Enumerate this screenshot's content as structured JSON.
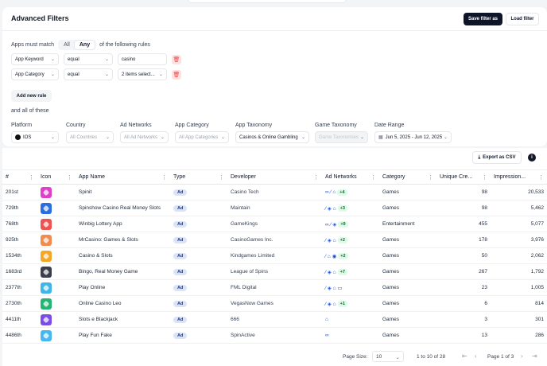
{
  "header": {
    "title": "Advanced Filters",
    "save_label": "Save filter as",
    "load_label": "Load filter"
  },
  "match": {
    "prefix": "Apps must match",
    "options": [
      "All",
      "Any"
    ],
    "selected": "Any",
    "suffix": "of the following rules"
  },
  "rules": [
    {
      "field": "App Keyword",
      "operator": "equal",
      "value": "casino"
    },
    {
      "field": "App Category",
      "operator": "equal",
      "value": "2 items select..."
    }
  ],
  "add_rule_label": "Add new rule",
  "and_all_label": "and all of these",
  "filters": {
    "platform": {
      "label": "Platform",
      "value": "IOS"
    },
    "country": {
      "label": "Country",
      "placeholder": "All Countries"
    },
    "ad_networks": {
      "label": "Ad Networks",
      "placeholder": "All Ad Networks"
    },
    "app_category": {
      "label": "App Category",
      "placeholder": "All App Categories"
    },
    "app_taxonomy": {
      "label": "App Taxonomy",
      "value": "Casinos & Online Gambling"
    },
    "game_taxonomy": {
      "label": "Game Taxonomy",
      "placeholder": "Game Taxonomies"
    },
    "date_range": {
      "label": "Date Range",
      "value": "Jun 5, 2025 - Jun 12, 2025"
    }
  },
  "export_label": "Export as CSV",
  "info_label": "i",
  "columns": [
    "#",
    "Icon",
    "App Name",
    "Type",
    "Developer",
    "Ad Networks",
    "Category",
    "Unique Cre...",
    "Impression..."
  ],
  "rows": [
    {
      "rank": "201st",
      "icon_color": "#e040c9",
      "name": "Spinit",
      "type": "Ad",
      "developer": "Casino Tech",
      "networks": "∞ ⁄ ⌂",
      "more": "+4",
      "category": "Games",
      "creatives": "98",
      "impressions": "20,533"
    },
    {
      "rank": "729th",
      "icon_color": "#2a6fe0",
      "name": "Spinshow Casino Real Money Slots",
      "type": "Ad",
      "developer": "Maintain",
      "networks": "⁄ ◈ ⌂",
      "more": "+3",
      "category": "Games",
      "creatives": "98",
      "impressions": "5,462"
    },
    {
      "rank": "768th",
      "icon_color": "#ef5350",
      "name": "Winbig Lottery App",
      "type": "Ad",
      "developer": "GameKings",
      "networks": "∞ ⁄ ◈",
      "more": "+9",
      "category": "Entertainment",
      "creatives": "455",
      "impressions": "5,077"
    },
    {
      "rank": "925th",
      "icon_color": "#f28b50",
      "name": "MrCasino: Games & Slots",
      "type": "Ad",
      "developer": "CasinoGames Inc.",
      "networks": "⁄ ◈ ⌂",
      "more": "+2",
      "category": "Games",
      "creatives": "178",
      "impressions": "3,976"
    },
    {
      "rank": "1534th",
      "icon_color": "#f5a623",
      "name": "Casino & Slots",
      "type": "Ad",
      "developer": "Kindgames Limited",
      "networks": "⁄ ⌂ ◉",
      "more": "+2",
      "category": "Games",
      "creatives": "50",
      "impressions": "2,062"
    },
    {
      "rank": "1683rd",
      "icon_color": "#3a3f4b",
      "name": "Bingo, Real Money Game",
      "type": "Ad",
      "developer": "League of Spins",
      "networks": "⁄ ◈ ⌂",
      "more": "+7",
      "category": "Games",
      "creatives": "267",
      "impressions": "1,792"
    },
    {
      "rank": "2377th",
      "icon_color": "#3fb6e8",
      "name": "Play Online",
      "type": "Ad",
      "developer": "FML Digital",
      "networks": "⁄ ◈ ⌂ ▭",
      "more": "",
      "category": "Games",
      "creatives": "23",
      "impressions": "1,005"
    },
    {
      "rank": "2730th",
      "icon_color": "#22b573",
      "name": "Online Casino Leo",
      "type": "Ad",
      "developer": "VegasNow Games",
      "networks": "⁄ ◈ ⌂",
      "more": "+1",
      "category": "Games",
      "creatives": "6",
      "impressions": "814"
    },
    {
      "rank": "4411th",
      "icon_color": "#7a4de8",
      "name": "Slots e Blackjack",
      "type": "Ad",
      "developer": "666",
      "networks": "⌂",
      "more": "",
      "category": "Games",
      "creatives": "3",
      "impressions": "301"
    },
    {
      "rank": "4486th",
      "icon_color": "#46b8f0",
      "name": "Play Fun Fake",
      "type": "Ad",
      "developer": "SpinActive",
      "networks": "∞",
      "more": "",
      "category": "Games",
      "creatives": "13",
      "impressions": "286"
    }
  ],
  "pagination": {
    "page_size_label": "Page Size:",
    "page_size": "10",
    "range": "1 to 10 of 28",
    "page": "Page 1 of 3"
  }
}
